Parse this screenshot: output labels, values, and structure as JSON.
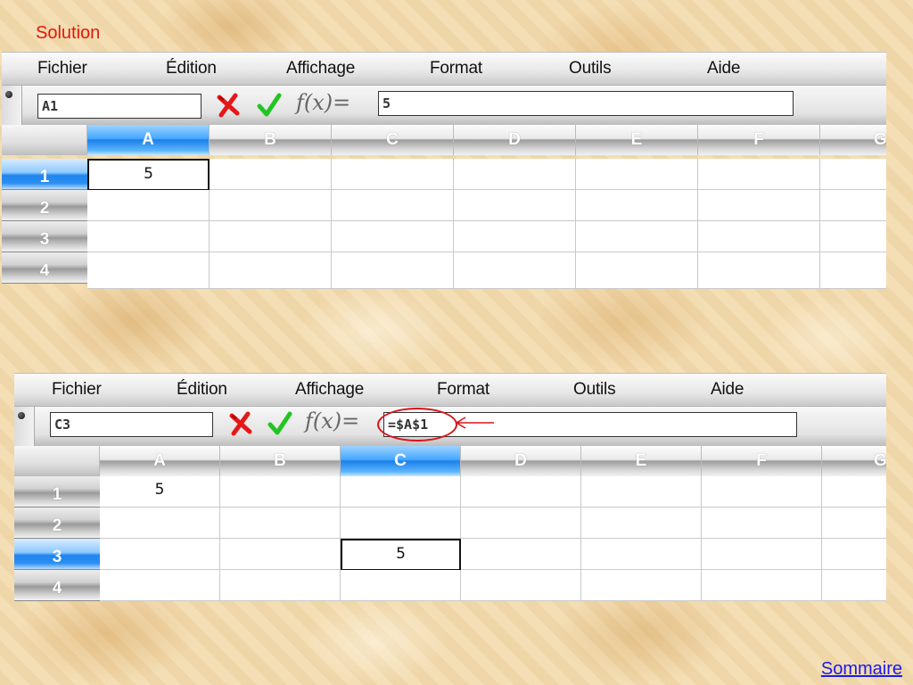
{
  "title": "Solution",
  "footer_link": "Sommaire",
  "menu": [
    "Fichier",
    "Édition",
    "Affichage",
    "Format",
    "Outils",
    "Aide"
  ],
  "columns": [
    "A",
    "B",
    "C",
    "D",
    "E",
    "F",
    "G"
  ],
  "rows": [
    "1",
    "2",
    "3",
    "4"
  ],
  "fx_label": "f(x)=",
  "panel1": {
    "name_box": "A1",
    "formula": "5",
    "active_column": "A",
    "active_row": "1",
    "cell_A1": "5"
  },
  "panel2": {
    "name_box": "C3",
    "formula": "=$A$1",
    "active_column": "C",
    "active_row": "3",
    "cell_A1": "5",
    "cell_C3": "5"
  },
  "colors": {
    "title": "#e3170a",
    "link": "#1a1aee",
    "active_header": "#1c7fe8",
    "annotation": "#d8141a"
  },
  "icons": [
    "cancel-x-icon",
    "accept-check-icon"
  ]
}
